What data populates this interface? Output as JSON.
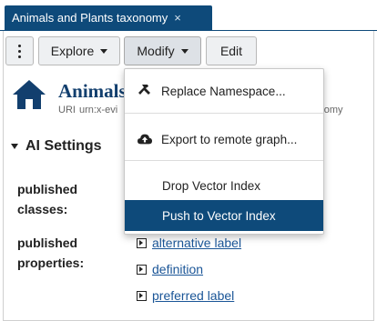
{
  "tab": {
    "title": "Animals and Plants taxonomy",
    "close_icon": "×"
  },
  "toolbar": {
    "explore_label": "Explore",
    "modify_label": "Modify",
    "edit_label": "Edit"
  },
  "resource": {
    "title": "Animals",
    "uri_label": "URI",
    "uri_value": "urn:x-evi",
    "uri_tail": "xonomy"
  },
  "ai_settings": {
    "section_title": "AI Settings",
    "published_classes_label": [
      "published",
      "classes:"
    ],
    "published_properties_label": [
      "published",
      "properties:"
    ],
    "properties": [
      "alternative label",
      "definition",
      "preferred label"
    ]
  },
  "modify_menu": {
    "items": [
      {
        "label": "Replace Namespace...",
        "icon": "hammer-icon"
      },
      {
        "label": "Export to remote graph...",
        "icon": "cloud-upload-icon"
      },
      {
        "label": "Drop Vector Index",
        "icon": ""
      },
      {
        "label": "Push to Vector Index",
        "icon": "",
        "highlighted": true
      }
    ]
  },
  "colors": {
    "accent": "#0e4a7a",
    "link": "#1a5597",
    "title": "#123f6e"
  }
}
